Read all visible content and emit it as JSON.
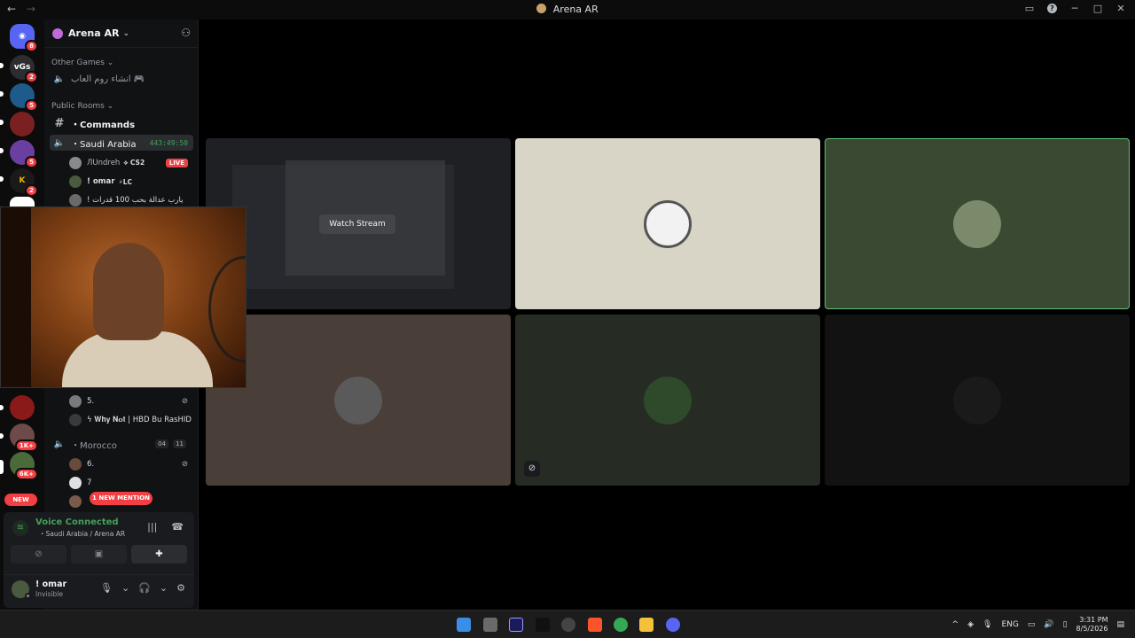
{
  "window": {
    "title": "Arena AR",
    "back": "←",
    "forward": "→"
  },
  "rail": {
    "servers": [
      {
        "label": "",
        "badge": "8",
        "color": "#5865f2"
      },
      {
        "label": "vGs",
        "badge": "2",
        "color": "#2b2d31"
      },
      {
        "label": "",
        "badge": "5",
        "color": "#1e5a8a"
      },
      {
        "label": "",
        "badge": "",
        "color": "#7a2020"
      },
      {
        "label": "",
        "badge": "5",
        "color": "#6b3fa0"
      },
      {
        "label": "K",
        "badge": "2",
        "color": "#1a1a1a"
      },
      {
        "label": "",
        "badge": "",
        "color": "#ffffff"
      },
      {
        "label": "",
        "badge": "",
        "color": "#8a1a1a"
      },
      {
        "label": "",
        "badge": "1K+",
        "color": "#6e4a4a"
      },
      {
        "label": "",
        "badge": "6K+",
        "color": "#4a6a3a"
      }
    ],
    "new_label": "NEW"
  },
  "guild": {
    "name": "Arena AR",
    "chevron": "⌄"
  },
  "categories": {
    "other_games": "Other Games ⌄",
    "public_rooms": "Public Rooms ⌄"
  },
  "channels": {
    "arabic_room": "انشاء روم العاب 🎮",
    "commands": "・Commands",
    "saudi": "・Saudi Arabia",
    "saudi_timer": "443:49:50",
    "morocco": "・Morocco",
    "morocco_count_a": "04",
    "morocco_count_b": "11"
  },
  "users": {
    "u1": {
      "name": "ЛUndreh",
      "tag": "⟡ CS2",
      "live": "LIVE"
    },
    "u2": {
      "name": "! omar",
      "tag": "⚡LC"
    },
    "u3": {
      "name": "! يارب عدالة بحب 100 قدرات"
    },
    "u5": {
      "name": "5."
    },
    "u6": {
      "name": "ϟ 𝐖𝐡𝐲 𝐍𝐨𝐭 | HBD Bu RasHID"
    },
    "u7": {
      "name": "6."
    },
    "u8": {
      "name": "7"
    }
  },
  "mention": "1 NEW MENTION",
  "voice": {
    "status": "Voice Connected",
    "sub": "・Saudi Arabia / Arena AR"
  },
  "me": {
    "name": "! omar",
    "status": "Invisible"
  },
  "stage": {
    "watch_label": "Watch Stream",
    "tiles": [
      {
        "bg": "#1e2024"
      },
      {
        "bg": "#d8d4c6"
      },
      {
        "bg": "#3a4a32"
      },
      {
        "bg": "#4a3f38"
      },
      {
        "bg": "#262c24"
      },
      {
        "bg": "#121212"
      }
    ]
  },
  "taskbar": {
    "lang": "ENG",
    "time": "3:31 PM",
    "date": "8/5/2026",
    "tray_up": "^"
  }
}
